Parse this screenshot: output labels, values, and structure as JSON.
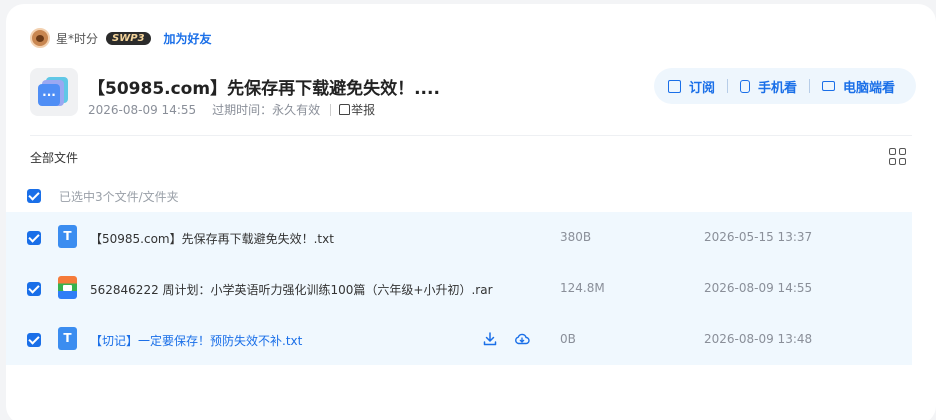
{
  "user": {
    "name": "星*时分",
    "vip": "SWP3",
    "add_friend": "加为好友"
  },
  "share": {
    "title": "【50985.com】先保存再下载避免失效！....",
    "date": "2026-08-09 14:55",
    "expire_label": "过期时间：",
    "expire_value": "永久有效",
    "report": "举报"
  },
  "actions": {
    "subscribe": "订阅",
    "mobile": "手机看",
    "desktop": "电脑端看"
  },
  "list": {
    "all_files": "全部文件",
    "selected_text": "已选中3个文件/文件夹"
  },
  "files": [
    {
      "name": "【50985.com】先保存再下载避免失效！.txt",
      "size": "380B",
      "date": "2026-05-15 13:37",
      "type": "txt"
    },
    {
      "name": "562846222 周计划：小学英语听力强化训练100篇（六年级+小升初）.rar",
      "size": "124.8M",
      "date": "2026-08-09 14:55",
      "type": "rar"
    },
    {
      "name": "【切记】一定要保存！预防失效不补.txt",
      "size": "0B",
      "date": "2026-08-09 13:48",
      "type": "txt"
    }
  ],
  "icons": {
    "txt_glyph": "T",
    "folder_glyph": "···"
  },
  "colors": {
    "accent": "#1a6fe8",
    "row_highlight": "#f0f8fe"
  }
}
